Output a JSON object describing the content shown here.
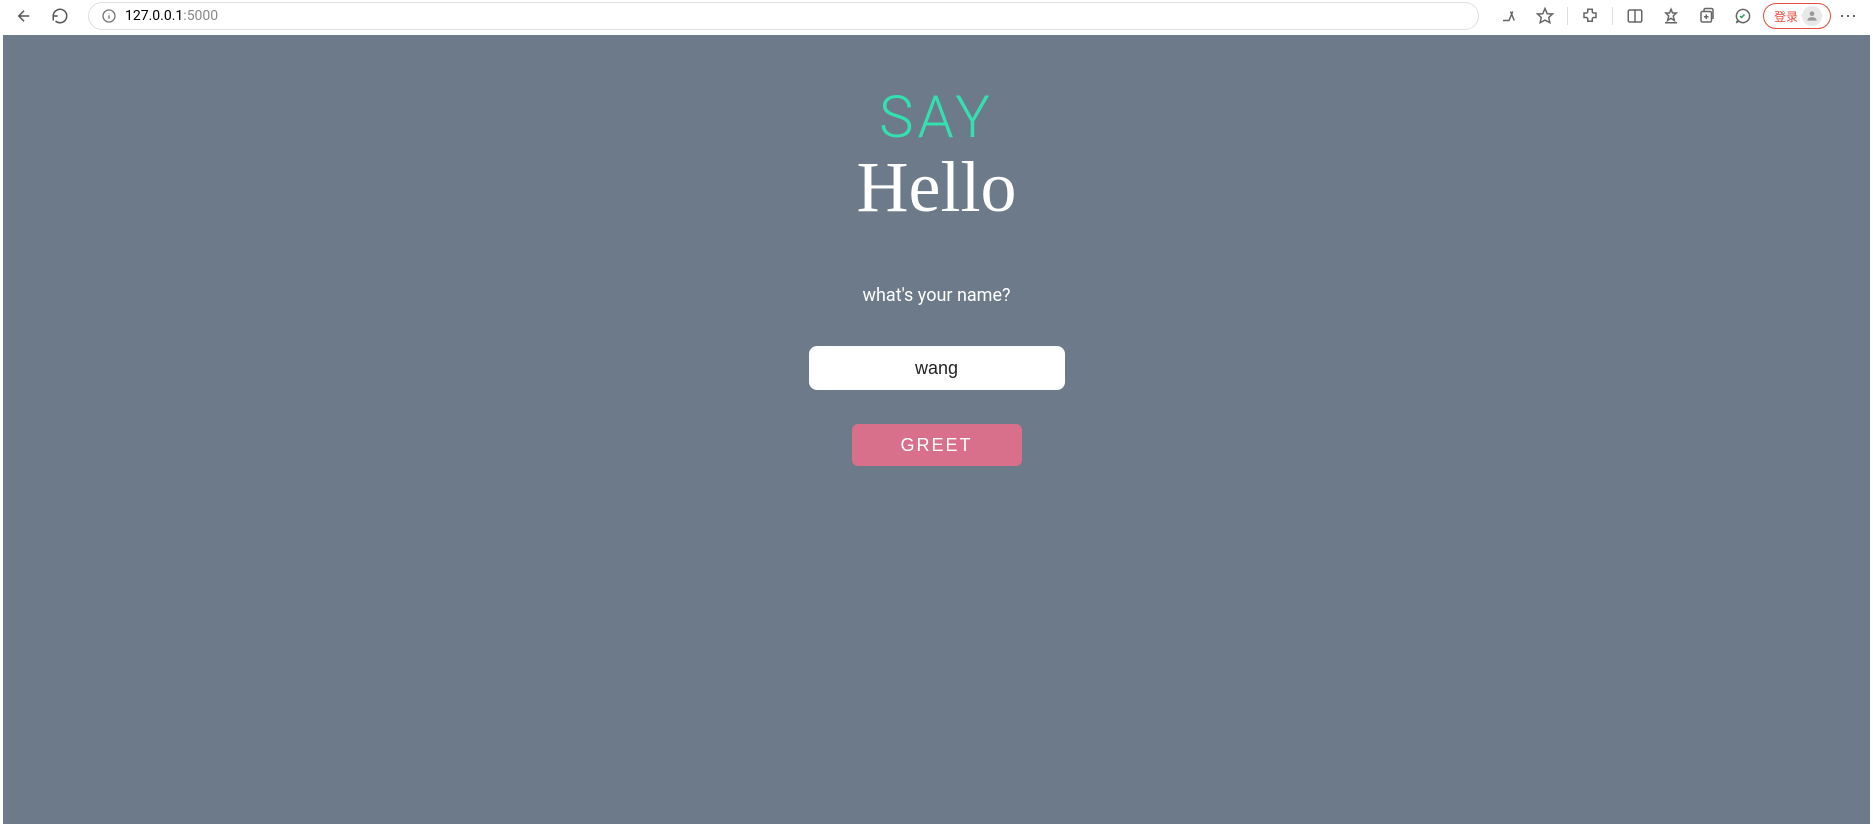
{
  "browser": {
    "url_host": "127.0.0.1",
    "url_port": ":5000",
    "login_label": "登录"
  },
  "app": {
    "title_line1": "SAY",
    "title_line2": "Hello",
    "prompt": "what's your name?",
    "name_value": "wang",
    "greet_button": "GREET",
    "colors": {
      "background": "#6c7a89",
      "accent_teal": "#35e0b0",
      "button_pink": "#d9708b"
    }
  }
}
